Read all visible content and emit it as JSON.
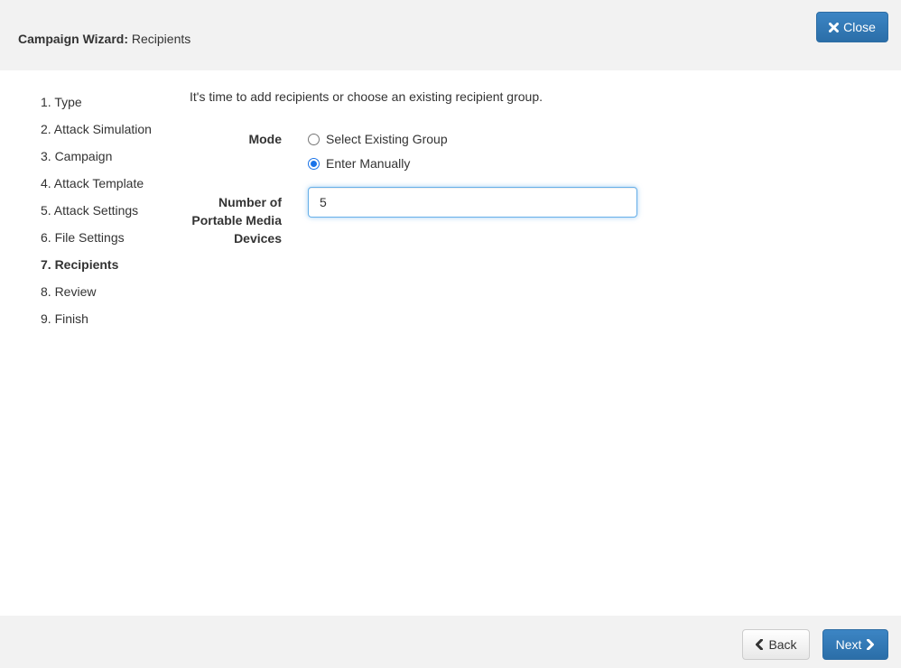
{
  "header": {
    "title_bold": "Campaign Wizard:",
    "title_rest": "Recipients",
    "close_label": "Close",
    "close_icon": "close-icon"
  },
  "steps": [
    {
      "label": "1. Type"
    },
    {
      "label": "2. Attack Simulation"
    },
    {
      "label": "3. Campaign"
    },
    {
      "label": "4. Attack Template"
    },
    {
      "label": "5. Attack Settings"
    },
    {
      "label": "6. File Settings"
    },
    {
      "label": "7. Recipients",
      "active": true
    },
    {
      "label": "8. Review"
    },
    {
      "label": "9. Finish"
    }
  ],
  "main": {
    "intro": "It's time to add recipients or choose an existing recipient group.",
    "mode_label": "Mode",
    "mode_options": [
      {
        "label": "Select Existing Group",
        "checked": false
      },
      {
        "label": "Enter Manually",
        "checked": true
      }
    ],
    "devices_label": "Number of Portable Media Devices",
    "devices_value": "5"
  },
  "footer": {
    "back_label": "Back",
    "next_label": "Next"
  },
  "colors": {
    "primary": "#337ab7",
    "header_bg": "#f2f2f2",
    "radio_accent": "#1a73e8"
  }
}
